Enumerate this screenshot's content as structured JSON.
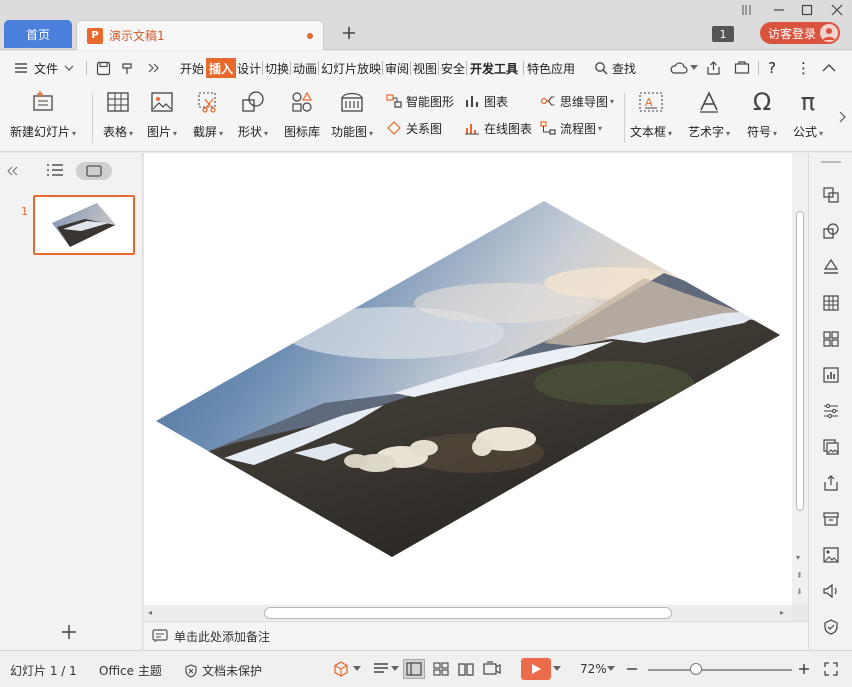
{
  "titlebar": {
    "home_tab": "首页",
    "doc_tab": "演示文稿1",
    "doc_icon": "P",
    "badge": "1",
    "login": "访客登录"
  },
  "menu": {
    "file": "文件",
    "tabs": [
      "开始",
      "插入",
      "设计",
      "切换",
      "动画",
      "幻灯片放映",
      "审阅",
      "视图",
      "安全",
      "开发工具",
      "特色应用"
    ],
    "active_tab": "插入",
    "search": "查找"
  },
  "ribbon": {
    "new_slide": "新建幻灯片",
    "table": "表格",
    "picture": "图片",
    "screenshot": "截屏",
    "shape": "形状",
    "icon_lib": "图标库",
    "function": "功能图",
    "smart_art": "智能图形",
    "chart": "图表",
    "relation": "关系图",
    "online_chart": "在线图表",
    "mindmap": "思维导图",
    "flowchart": "流程图",
    "textbox": "文本框",
    "wordart": "艺术字",
    "symbol": "符号",
    "formula": "公式"
  },
  "slides": {
    "current_number": "1"
  },
  "notes": {
    "placeholder": "单击此处添加备注"
  },
  "status": {
    "slide_count": "幻灯片 1 / 1",
    "theme": "Office 主题",
    "protection": "文档未保护",
    "zoom": "72%"
  },
  "colors": {
    "accent": "#e8692e",
    "home_tab": "#4a7fdc",
    "login": "#d9533e",
    "play": "#ec6b4a"
  }
}
